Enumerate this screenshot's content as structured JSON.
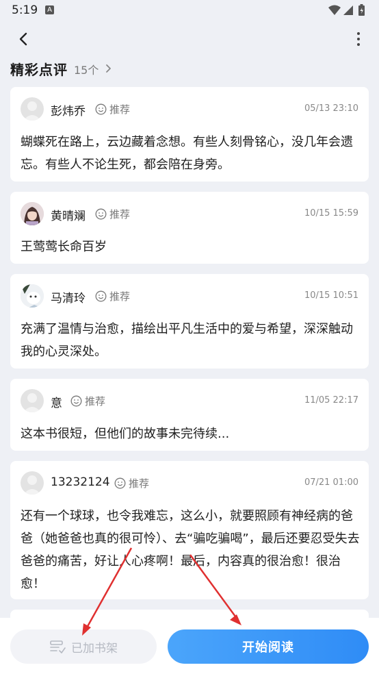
{
  "status_bar": {
    "time": "5:19",
    "notification_badge": "A",
    "icons": [
      "wifi-icon",
      "signal-icon",
      "battery-charging-icon"
    ]
  },
  "top_bar": {
    "back_icon": "chevron-left-icon",
    "more_icon": "more-vertical-icon"
  },
  "section": {
    "title": "精彩点评",
    "count": "15个",
    "chevron_icon": "chevron-right-icon"
  },
  "reviews": [
    {
      "name": "彭炜乔",
      "recommend_label": "推荐",
      "date": "05/13 23:10",
      "text": "蝴蝶死在路上，云边藏着念想。有些人刻骨铭心，没几年会遗忘。有些人不论生死，都会陪在身旁。"
    },
    {
      "name": "黄晴斓",
      "recommend_label": "推荐",
      "date": "10/15 15:59",
      "text": "王莺莺长命百岁"
    },
    {
      "name": "马清玲",
      "recommend_label": "推荐",
      "date": "10/15 10:51",
      "text": "充满了温情与治愈，描绘出平凡生活中的爱与希望，深深触动我的心灵深处。"
    },
    {
      "name": "意",
      "recommend_label": "推荐",
      "date": "11/05 22:17",
      "text": "这本书很短，但他们的故事未完待续..."
    },
    {
      "name": "13232124",
      "recommend_label": "推荐",
      "date": "07/21 01:00",
      "text": "还有一个球球，也令我难忘，这么小，就要照顾有神经病的爸爸（她爸爸也真的很可怜）、去“骗吃骗喝”，最后还要忍受失去爸爸的痛苦，好让人心疼啊！最后，内容真的很治愈！很治愈！"
    }
  ],
  "bottom_bar": {
    "shelf_label": "已加书架",
    "read_label": "开始阅读"
  },
  "colors": {
    "accent": "#2f8cf6",
    "annotation_arrow": "#e03030",
    "background": "#eef0f5"
  }
}
